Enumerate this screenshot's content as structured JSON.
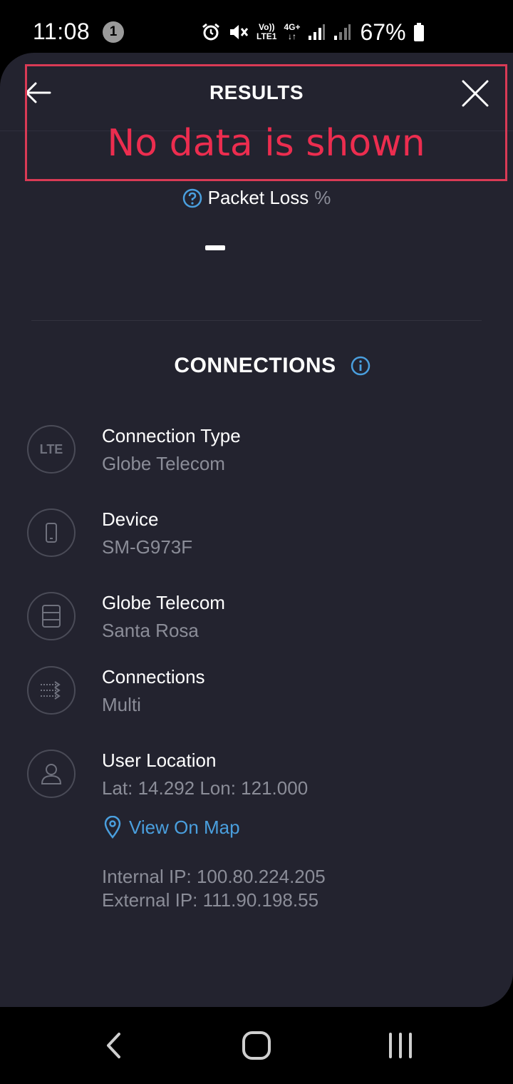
{
  "status_bar": {
    "time": "11:08",
    "notification_count": "1",
    "network_top": "Vo))",
    "network_bottom": "LTE1",
    "network_type": "4G+",
    "battery_percent": "67%"
  },
  "header": {
    "title": "RESULTS",
    "back_icon": "arrow-left-icon",
    "close_icon": "close-icon"
  },
  "annotation": {
    "text": "No data is shown",
    "color": "#ec2d4f"
  },
  "packet_loss": {
    "label": "Packet Loss",
    "unit": "%",
    "value": "–"
  },
  "connections": {
    "title": "CONNECTIONS",
    "items": [
      {
        "icon": "lte-icon",
        "icon_text": "LTE",
        "title": "Connection Type",
        "subtitle": "Globe Telecom"
      },
      {
        "icon": "phone-icon",
        "title": "Device",
        "subtitle": "SM-G973F"
      },
      {
        "icon": "server-icon",
        "title": "Globe Telecom",
        "subtitle": "Santa Rosa"
      },
      {
        "icon": "multi-connection-icon",
        "title": "Connections",
        "subtitle": "Multi"
      },
      {
        "icon": "user-icon",
        "title": "User Location",
        "subtitle": "Lat: 14.292 Lon: 121.000"
      }
    ],
    "map_link": "View On Map",
    "internal_ip": "Internal IP: 100.80.224.205",
    "external_ip": "External IP: 111.90.198.55"
  },
  "colors": {
    "panel_background": "#23232f",
    "accent": "#4a9fde",
    "muted_text": "#8b8d98"
  }
}
